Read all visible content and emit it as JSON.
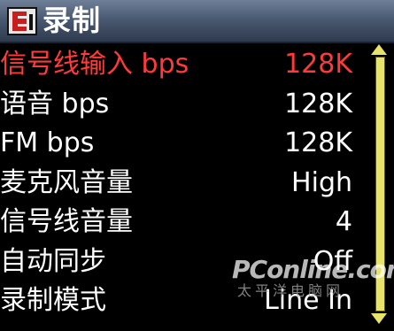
{
  "title": "录制",
  "accent_color": "#ff3a3a",
  "scrollbar_color": "#e8e36a",
  "scroll_fraction_visible": 1.0,
  "menu": [
    {
      "label": "信号线输入 bps",
      "value": "128K",
      "selected": true
    },
    {
      "label": "语音 bps",
      "value": "128K"
    },
    {
      "label": "FM bps",
      "value": "128K"
    },
    {
      "label": "麦克风音量",
      "value": "High"
    },
    {
      "label": "信号线音量",
      "value": "4"
    },
    {
      "label": "自动同步",
      "value": "Off"
    },
    {
      "label": "录制模式",
      "value": "Line In"
    }
  ],
  "watermark": {
    "logo": "PConline.com.cn",
    "sub": "太平洋电脑网"
  }
}
